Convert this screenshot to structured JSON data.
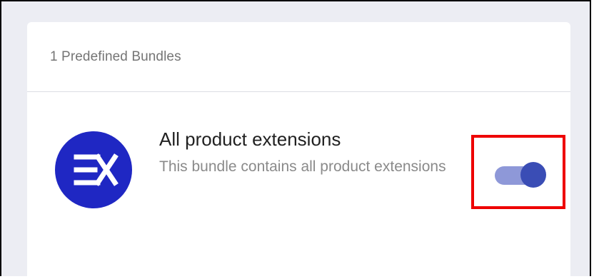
{
  "bundles_panel": {
    "header_title": "1 Predefined Bundles",
    "bundle": {
      "logo_icon": "ex-logo-icon",
      "logo_color": "#1f27c3",
      "title": "All product extensions",
      "description": "This bundle contains all product extensions",
      "toggle_state": "on",
      "toggle_track_color": "#8e98d8",
      "toggle_knob_color": "#3a4db5"
    },
    "highlight_color": "#ee0000"
  }
}
